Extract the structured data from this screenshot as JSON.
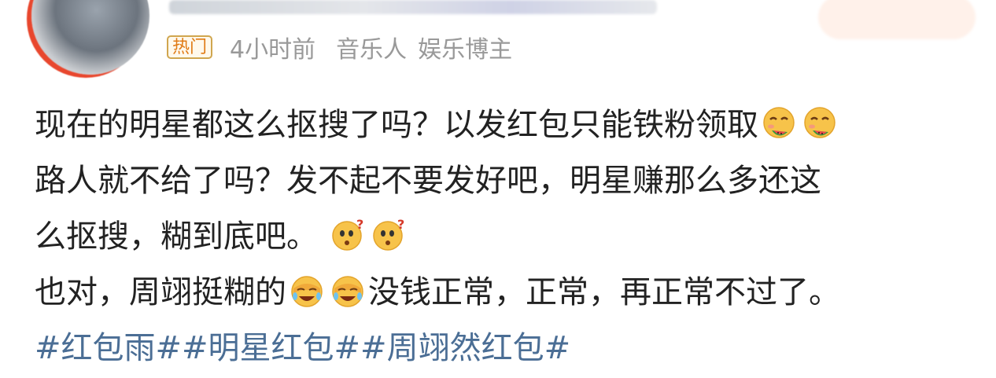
{
  "header": {
    "badge": "热门",
    "time": "4小时前",
    "tags": [
      "音乐人",
      "娱乐博主"
    ]
  },
  "post": {
    "lines": [
      "现在的明星都这么抠搜了吗？以发红包只能铁粉领取",
      "路人就不给了吗？发不起不要发好吧，明星赚那么多还这",
      "么抠搜，糊到底吧。",
      "也对，周翊挺糊的",
      "没钱正常，正常，再正常不过了。"
    ],
    "topics": "#红包雨##明星红包##周翊然红包#"
  },
  "icons": {
    "line1": [
      "watermelon-face-icon",
      "watermelon-face-icon"
    ],
    "line3": [
      "puzzled-face-icon",
      "puzzled-face-icon"
    ],
    "line4": [
      "facepalm-laugh-icon",
      "facepalm-laugh-icon"
    ]
  },
  "colors": {
    "badge_border": "#d0a64f",
    "badge_text": "#e07b15",
    "meta_text": "#999999",
    "body_text": "#222222",
    "topic_text": "#4b6e95"
  }
}
